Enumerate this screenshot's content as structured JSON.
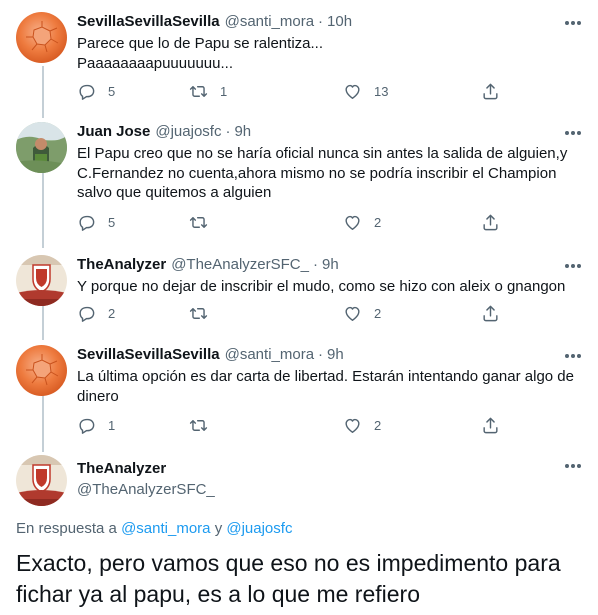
{
  "tweets": [
    {
      "name": "SevillaSevillaSevilla",
      "handle": "@santi_mora",
      "time": "10h",
      "text": "Parece que lo de Papu se ralentiza...\nPaaaaaaaapuuuuuuu...",
      "replies": "5",
      "retweets": "1",
      "likes": "13",
      "avatar": "orange-ball"
    },
    {
      "name": "Juan Jose",
      "handle": "@juajosfc",
      "time": "9h",
      "text": "El Papu creo que no se haría oficial nunca sin antes la salida de alguien,y C.Fernandez no cuenta,ahora mismo no se podría inscribir el Champion salvo que quitemos a alguien",
      "replies": "5",
      "retweets": "",
      "likes": "2",
      "avatar": "outdoor-photo"
    },
    {
      "name": "TheAnalyzer",
      "handle": "@TheAnalyzerSFC_",
      "time": "9h",
      "text": "Y porque no dejar de inscribir el mudo, como se hizo con aleix o gnangon",
      "replies": "2",
      "retweets": "",
      "likes": "2",
      "avatar": "sevilla-crest"
    },
    {
      "name": "SevillaSevillaSevilla",
      "handle": "@santi_mora",
      "time": "9h",
      "text": "La última opción es dar carta de libertad. Estarán intentando ganar algo de dinero",
      "replies": "1",
      "retweets": "",
      "likes": "2",
      "avatar": "orange-ball"
    }
  ],
  "main_tweet": {
    "name": "TheAnalyzer",
    "handle": "@TheAnalyzerSFC_",
    "replying_prefix": "En respuesta a",
    "reply_to_1": "@santi_mora",
    "reply_and": "y",
    "reply_to_2": "@juajosfc",
    "text": "Exacto, pero vamos que eso no es impedimento para fichar ya al papu, es a lo que me refiero"
  },
  "colors": {
    "accent": "#1d9bf0",
    "secondary": "#536471",
    "thread_line": "#c4cfd6"
  },
  "icons": [
    "reply-icon",
    "retweet-icon",
    "like-icon",
    "share-icon",
    "more-icon"
  ]
}
